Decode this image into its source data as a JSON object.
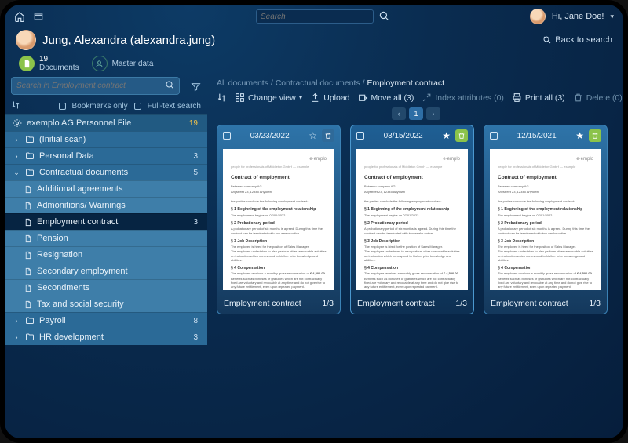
{
  "top": {
    "search_placeholder": "Search",
    "greeting": "Hi, Jane Doe!",
    "back": "Back to search"
  },
  "person": {
    "display": "Jung, Alexandra (alexandra.jung)",
    "doc_count": "19",
    "doc_label": "Documents",
    "master": "Master data"
  },
  "sidebar": {
    "search_placeholder": "Search in Employment contract",
    "bookmarks": "Bookmarks only",
    "fulltext": "Full-text search",
    "root": {
      "label": "exemplo AG Personnel File",
      "count": "19"
    },
    "items": [
      {
        "label": "(Initial scan)",
        "count": "",
        "level": 0,
        "open": false
      },
      {
        "label": "Personal Data",
        "count": "3",
        "level": 0,
        "open": false
      },
      {
        "label": "Contractual documents",
        "count": "5",
        "level": 0,
        "open": true,
        "children": [
          {
            "label": "Additional agreements"
          },
          {
            "label": "Admonitions/ Warnings"
          },
          {
            "label": "Employment contract",
            "count": "3",
            "selected": true
          },
          {
            "label": "Pension"
          },
          {
            "label": "Resignation"
          },
          {
            "label": "Secondary employment"
          },
          {
            "label": "Secondments"
          },
          {
            "label": "Tax and social security"
          }
        ]
      },
      {
        "label": "Payroll",
        "count": "8",
        "level": 0,
        "open": false
      },
      {
        "label": "HR development",
        "count": "3",
        "level": 0,
        "open": false
      }
    ]
  },
  "breadcrumbs": {
    "a": "All documents",
    "b": "Contractual documents",
    "c": "Employment contract"
  },
  "toolbar": {
    "change_view": "Change view",
    "upload": "Upload",
    "move_all": "Move all (3)",
    "index": "Index attributes (0)",
    "print": "Print all (3)",
    "delete": "Delete (0)"
  },
  "pager": {
    "page": "1"
  },
  "cards": [
    {
      "date": "03/23/2022",
      "title": "Employment contract",
      "pages": "1/3",
      "starred": false,
      "active": false
    },
    {
      "date": "03/15/2022",
      "title": "Employment contract",
      "pages": "1/3",
      "starred": true,
      "active": true
    },
    {
      "date": "12/15/2021",
      "title": "Employment contract",
      "pages": "1/3",
      "starred": true,
      "active": false
    }
  ],
  "doc_preview": {
    "brand": "e·emplo",
    "subtitle": "people for professionals of Middleton GmbH — example",
    "heading": "Contract of employment",
    "s1": "§ 1 Beginning of the employment relationship",
    "s2": "§ 2 Probationary period",
    "s3": "§ 3 Job Description",
    "s4": "§ 4 Compensation"
  }
}
